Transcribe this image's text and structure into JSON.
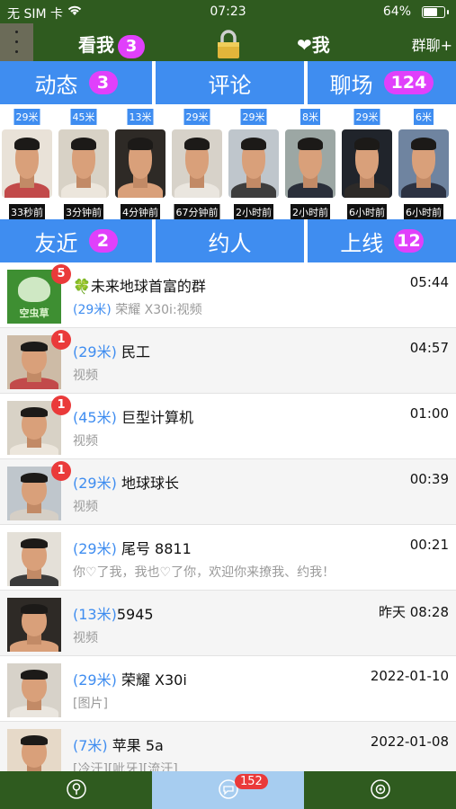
{
  "status": {
    "carrier": "无 SIM 卡",
    "time": "07:23",
    "battery": "64%",
    "battery_level": 0.64
  },
  "nav": {
    "lookme": "看我",
    "lookme_count": "3",
    "heartme": "❤我",
    "groupchat": "群聊+"
  },
  "tabs1": [
    {
      "label": "动态",
      "badge": "3"
    },
    {
      "label": "评论",
      "badge": ""
    },
    {
      "label": "聊场",
      "badge": "124"
    }
  ],
  "nearby": [
    {
      "distance": "29米",
      "ago": "33秒前",
      "bg": "#e9e2d8",
      "shirt": "#c24a4a"
    },
    {
      "distance": "45米",
      "ago": "3分钟前",
      "bg": "#d8d2c6",
      "shirt": "#ece6dc"
    },
    {
      "distance": "13米",
      "ago": "4分钟前",
      "bg": "#2e2a26",
      "shirt": "#d9a07a"
    },
    {
      "distance": "29米",
      "ago": "67分钟前",
      "bg": "#d7d2c9",
      "shirt": "#eae6df"
    },
    {
      "distance": "29米",
      "ago": "2小时前",
      "bg": "#bfc6cc",
      "shirt": "#3d3d3d"
    },
    {
      "distance": "8米",
      "ago": "2小时前",
      "bg": "#9ca7a4",
      "shirt": "#2a2f3a"
    },
    {
      "distance": "29米",
      "ago": "6小时前",
      "bg": "#20242b",
      "shirt": "#2d2a28"
    },
    {
      "distance": "6米",
      "ago": "6小时前",
      "bg": "#6f84a0",
      "shirt": "#2c3242"
    }
  ],
  "tabs2": [
    {
      "label": "友近",
      "badge": "2"
    },
    {
      "label": "约人",
      "badge": ""
    },
    {
      "label": "上线",
      "badge": "12"
    }
  ],
  "list": [
    {
      "badge": "5",
      "distance": "",
      "name": "🍀未来地球首富的群",
      "sub_distance": "(29米)",
      "sub": " 荣耀 X30i:视频",
      "time": "05:44",
      "group": true,
      "logo_text": "空虫草"
    },
    {
      "badge": "1",
      "distance": "(29米)",
      "name": " 民工",
      "sub_distance": "",
      "sub": "视频",
      "time": "04:57",
      "bg": "#cdbba6",
      "shirt": "#c24a4a"
    },
    {
      "badge": "1",
      "distance": "(45米)",
      "name": " 巨型计算机",
      "sub_distance": "",
      "sub": "视频",
      "time": "01:00",
      "bg": "#d8d2c6",
      "shirt": "#ece6dc"
    },
    {
      "badge": "1",
      "distance": "(29米)",
      "name": " 地球球长",
      "sub_distance": "",
      "sub": "视频",
      "time": "00:39",
      "bg": "#bfc6cc",
      "shirt": "#d5cfc6"
    },
    {
      "badge": "",
      "distance": "(29米)",
      "name": " 尾号 8811",
      "sub_distance": "",
      "sub": "你♡了我，我也♡了你，欢迎你来撩我、约我！",
      "time": "00:21",
      "bg": "#e4e0d8",
      "shirt": "#3a3a3a"
    },
    {
      "badge": "",
      "distance": "(13米)",
      "name": "5945",
      "sub_distance": "",
      "sub": "视频",
      "time": "昨天 08:28",
      "bg": "#2e2a26",
      "shirt": "#d9a07a"
    },
    {
      "badge": "",
      "distance": "(29米)",
      "name": " 荣耀 X30i",
      "sub_distance": "",
      "sub": "[图片]",
      "time": "2022-01-10",
      "bg": "#d7d2c9",
      "shirt": "#eae6df"
    },
    {
      "badge": "",
      "distance": "(7米)",
      "name": " 苹果 5a",
      "sub_distance": "",
      "sub": "[冷汗][呲牙][流汗]",
      "time": "2022-01-08",
      "bg": "#e6d9c8",
      "shirt": "#caa57a"
    }
  ],
  "tabbar": {
    "chat_badge": "152"
  },
  "colors": {
    "nav_green": "#2f5b1f",
    "tab_blue": "#3f8df0",
    "badge_purple": "#e040fb",
    "badge_red": "#ea3a3a"
  }
}
